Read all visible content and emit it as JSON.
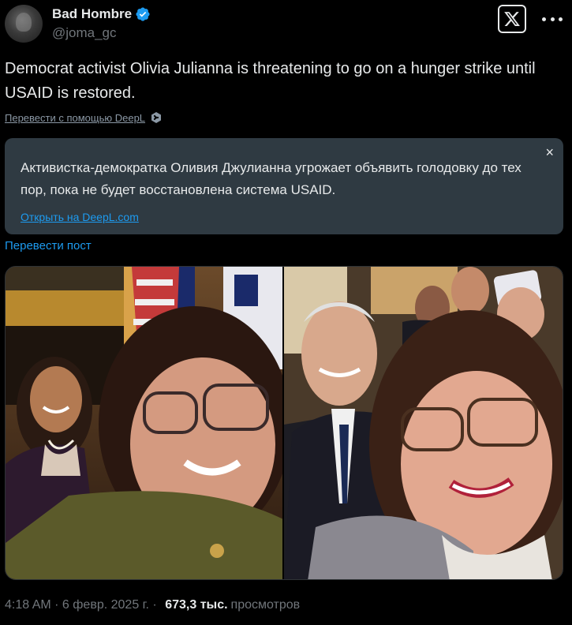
{
  "author": {
    "display_name": "Bad Hombre",
    "handle": "@joma_gc",
    "verified": true,
    "avatar_icon": "avatar-photo"
  },
  "header": {
    "brand_icon": "x-logo-icon",
    "more_icon": "more-dots-icon"
  },
  "tweet": {
    "text": "Democrat activist Olivia Julianna is threatening to go on a hunger strike until USAID is restored.",
    "deepl_link": "Перевести с помощью DeepL"
  },
  "translation": {
    "text": "Активистка-демократка Оливия Джулианна угрожает объявить голодовку до тех пор, пока не будет восстановлена система USAID.",
    "open_link": "Открыть на DeepL.com",
    "close_label": "×"
  },
  "translate_post": "Перевести пост",
  "meta": {
    "time": "4:18 AM",
    "sep1": " · ",
    "date": "6 февр. 2025 г.",
    "sep2": " · ",
    "views_count": "673,3 тыс.",
    "views_label": "просмотров"
  },
  "colors": {
    "background": "#000000",
    "accent": "#1d9bf0",
    "muted": "#71767b",
    "translation_box": "#2f3a42"
  }
}
